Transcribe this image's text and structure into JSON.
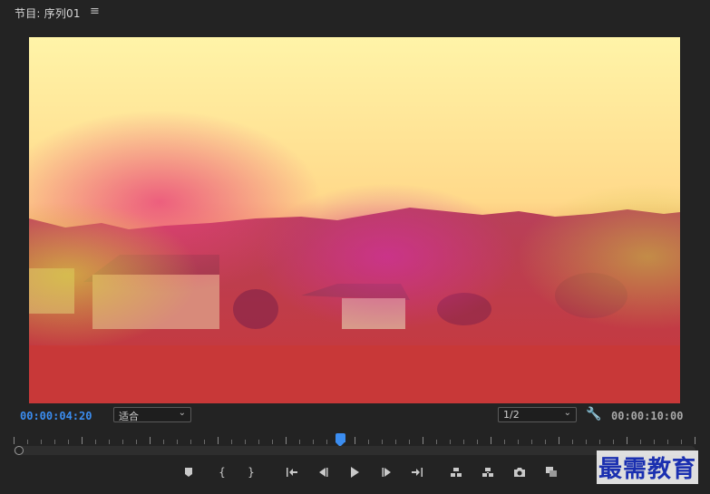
{
  "panel": {
    "title": "节目: 序列01",
    "menu_icon": "hamburger-menu-icon"
  },
  "timecode": {
    "current": "00:00:04:20",
    "total": "00:00:10:00"
  },
  "zoom_select": {
    "value": "适合"
  },
  "resolution_select": {
    "value": "1/2"
  },
  "settings_icon": "wrench-icon",
  "playhead_position": 0.48,
  "transport": [
    {
      "name": "add-marker-button",
      "icon": "marker-icon"
    },
    {
      "name": "mark-in-button",
      "icon": "mark-in-icon",
      "glyph": "{"
    },
    {
      "name": "mark-out-button",
      "icon": "mark-out-icon",
      "glyph": "}"
    },
    {
      "name": "go-to-in-button",
      "icon": "go-to-in-icon"
    },
    {
      "name": "step-back-button",
      "icon": "step-back-icon"
    },
    {
      "name": "play-button",
      "icon": "play-icon"
    },
    {
      "name": "step-forward-button",
      "icon": "step-forward-icon"
    },
    {
      "name": "go-to-out-button",
      "icon": "go-to-out-icon"
    },
    {
      "name": "lift-button",
      "icon": "lift-icon"
    },
    {
      "name": "extract-button",
      "icon": "extract-icon"
    },
    {
      "name": "export-frame-button",
      "icon": "camera-icon"
    },
    {
      "name": "comparison-view-button",
      "icon": "comparison-icon"
    }
  ],
  "watermark": "最需教育",
  "colors": {
    "accent": "#3b8df0",
    "background": "#232323"
  }
}
